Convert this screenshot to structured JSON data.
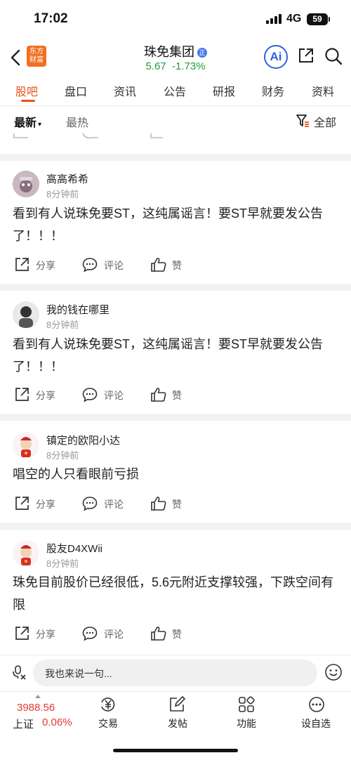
{
  "status_bar": {
    "time": "17:02",
    "network": "4G",
    "battery": "59"
  },
  "header": {
    "logo_text": "东方财富",
    "stock_name": "珠免集团",
    "badge": "正",
    "price": "5.67",
    "change": "-1.73%",
    "ai_label": "Ai"
  },
  "tabs": [
    "股吧",
    "盘口",
    "资讯",
    "公告",
    "研报",
    "财务",
    "资料"
  ],
  "filter": {
    "sort_new": "最新",
    "sort_hot": "最热",
    "all_label": "全部"
  },
  "actions": {
    "share": "分享",
    "comment": "评论",
    "like": "赞"
  },
  "posts": [
    {
      "user": "高高希希",
      "time": "8分钟前",
      "text": "看到有人说珠免要ST，这纯属谣言！要ST早就要发公告了！！！"
    },
    {
      "user": "我的钱在哪里",
      "time": "8分钟前",
      "text": "看到有人说珠免要ST，这纯属谣言！要ST早就要发公告了！！！"
    },
    {
      "user": "镇定的欧阳小达",
      "time": "8分钟前",
      "text": "唱空的人只看眼前亏损"
    },
    {
      "user": "股友D4XWii",
      "time": "8分钟前",
      "text": "珠免目前股价已经很低，5.6元附近支撑较强，下跌空间有限"
    }
  ],
  "composer": {
    "placeholder": "我也来说一句..."
  },
  "toolbar": {
    "index_value": "3988.56",
    "index_name": "上证",
    "index_change": "0.06%",
    "items": [
      "交易",
      "发帖",
      "功能",
      "设自选"
    ]
  },
  "colors": {
    "accent": "#e8531f",
    "down": "#1f9d3a",
    "up": "#e53935",
    "ai": "#2d63d8"
  }
}
